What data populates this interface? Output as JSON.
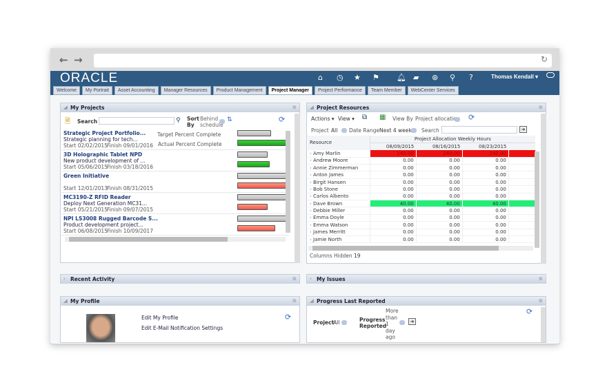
{
  "browser": {
    "back": "←",
    "forward": "→",
    "reload": "↻"
  },
  "header": {
    "logo": "ORACLE",
    "user": "Thomas Kendall ▾",
    "icons": [
      "home-icon",
      "clock-icon",
      "star-icon",
      "flag-icon",
      "bell-icon",
      "chat-icon",
      "accessibility-icon",
      "search-icon",
      "help-icon"
    ]
  },
  "tabs": [
    "Welcome",
    "My Portrait",
    "Asset Accounting",
    "Manager Resources",
    "Product Management",
    "Project Manager",
    "Project Performance",
    "Team Member",
    "WebCenter Services"
  ],
  "active_tab": "Project Manager",
  "my_projects": {
    "title": "My Projects",
    "search_label": "Search",
    "search_value": "",
    "sort_label": "Sort By",
    "sort_value": "Behind schedule",
    "target_label": "Target Percent Complete",
    "actual_label": "Actual Percent Complete",
    "projects": [
      {
        "name": "Strategic Project Portfolio...",
        "desc": "Strategic planning for tech...",
        "start": "Start 02/02/2015",
        "finish": "Finish 09/01/2016",
        "target": 0.65,
        "actual": 1.0,
        "status": "on-track"
      },
      {
        "name": "3D Holographic Tablet NPD",
        "desc": "New product development of ...",
        "start": "Start 05/06/2015",
        "finish": "Finish 03/18/2016",
        "target": 0.58,
        "actual": 0.63,
        "status": "on-track"
      },
      {
        "name": "Green Initiative",
        "desc": "",
        "start": "Start 12/01/2013",
        "finish": "Finish 08/31/2015",
        "target": 1.0,
        "actual": 1.0,
        "status": "behind"
      },
      {
        "name": "MC3190-Z RFID Reader",
        "desc": "Deploy Next Generation MC31...",
        "start": "Start 05/21/2015",
        "finish": "Finish 09/07/2015",
        "target": 1.0,
        "actual": 0.58,
        "status": "behind"
      },
      {
        "name": "NPI LS3008 Rugged Barcode S...",
        "desc": "Product development project...",
        "start": "Start 06/08/2015",
        "finish": "Finish 10/09/2017",
        "target": 1.0,
        "actual": 0.73,
        "status": "behind"
      }
    ]
  },
  "resources": {
    "title": "Project Resources",
    "actions": "Actions ▾",
    "view": "View ▾",
    "view_by_label": "View By",
    "view_by_value": "Project allocation",
    "project_label": "Project",
    "project_value": "All",
    "date_range_label": "Date Range",
    "date_range_value": "Next 4 weeks",
    "search_label": "Search",
    "col_resource": "Resource",
    "group_header": "Project Allocation Weekly Hours",
    "dates": [
      "08/09/2015",
      "08/16/2015",
      "08/23/2015"
    ],
    "rows": [
      {
        "name": "Amy Marlin",
        "vals": [
          "240.00",
          "240.00",
          "240.00"
        ],
        "hl": "over"
      },
      {
        "name": "Andrew Moore",
        "vals": [
          "0.00",
          "0.00",
          "0.00"
        ]
      },
      {
        "name": "Annie Zimmerman",
        "vals": [
          "0.00",
          "0.00",
          "0.00"
        ]
      },
      {
        "name": "Anton James",
        "vals": [
          "0.00",
          "0.00",
          "0.00"
        ]
      },
      {
        "name": "Birgit Hansen",
        "vals": [
          "0.00",
          "0.00",
          "0.00"
        ]
      },
      {
        "name": "Bob Stone",
        "vals": [
          "0.00",
          "0.00",
          "0.00"
        ]
      },
      {
        "name": "Carlos Albento",
        "vals": [
          "0.00",
          "0.00",
          "0.00"
        ]
      },
      {
        "name": "Dave Brown",
        "vals": [
          "40.00",
          "40.00",
          "40.00"
        ],
        "hl": "full"
      },
      {
        "name": "Debbie Miller",
        "vals": [
          "0.00",
          "0.00",
          "0.00"
        ]
      },
      {
        "name": "Emma Doyle",
        "vals": [
          "0.00",
          "0.00",
          "0.00"
        ]
      },
      {
        "name": "Emma Watson",
        "vals": [
          "0.00",
          "0.00",
          "0.00"
        ]
      },
      {
        "name": "James Merritt",
        "vals": [
          "0.00",
          "0.00",
          "0.00"
        ]
      },
      {
        "name": "Jamie North",
        "vals": [
          "0.00",
          "0.00",
          "0.00"
        ]
      }
    ],
    "columns_hidden_label": "Columns Hidden",
    "columns_hidden": "19"
  },
  "recent_activity": {
    "title": "Recent Activity"
  },
  "my_issues": {
    "title": "My Issues"
  },
  "my_profile": {
    "title": "My Profile",
    "edit_profile": "Edit My Profile",
    "edit_email": "Edit E-Mail Notification Settings"
  },
  "progress": {
    "title": "Progress Last Reported",
    "project_label": "Project",
    "project_value": "All",
    "reported_label": "Progress Reported",
    "reported_value": "More than 1 day ago"
  },
  "colors": {
    "header": "#2e5a83",
    "over": "#ee1111",
    "full": "#22ee77",
    "on_track": "#22aa22",
    "behind": "#ee6655"
  }
}
